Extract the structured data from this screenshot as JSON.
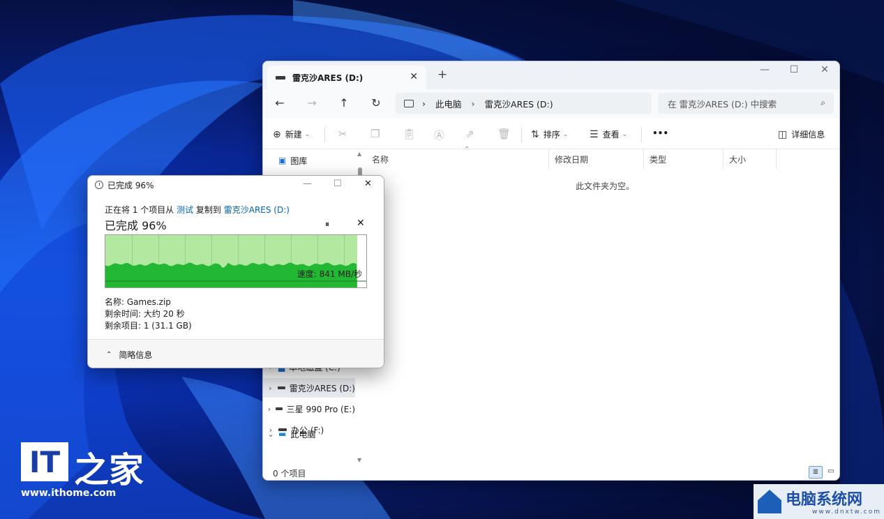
{
  "explorer": {
    "tab_title": "雷克沙ARES (D:)",
    "tab_close": "✕",
    "new_tab": "+",
    "controls": {
      "minimize": "—",
      "maximize": "☐",
      "close": "✕"
    },
    "nav": {
      "back": "←",
      "forward": "→",
      "up": "↑",
      "refresh": "↻"
    },
    "breadcrumb": [
      "此电脑",
      "雷克沙ARES (D:)"
    ],
    "breadcrumb_sep": "›",
    "search_placeholder": "在 雷克沙ARES (D:) 中搜索",
    "toolbar": {
      "new_label": "新建",
      "sort_label": "排序",
      "view_label": "查看",
      "more_label": "•••",
      "details_label": "详细信息"
    },
    "sidebar": {
      "items": [
        {
          "label": "图库",
          "icon": "gallery-icon",
          "chev": ""
        },
        {
          "label": "此电脑",
          "icon": "pc-icon",
          "chev": "⌄"
        },
        {
          "label": "本地磁盘 (C:)",
          "icon": "disk-icon",
          "chev": "›"
        },
        {
          "label": "雷克沙ARES (D:)",
          "icon": "drive-icon",
          "chev": "›",
          "selected": true
        },
        {
          "label": "三星 990 Pro (E:)",
          "icon": "drive-icon",
          "chev": "›"
        },
        {
          "label": "办公 (F:)",
          "icon": "drive-icon",
          "chev": "›"
        }
      ]
    },
    "columns": [
      "名称",
      "修改日期",
      "类型",
      "大小"
    ],
    "empty_message": "此文件夹为空。",
    "status": "0 个项目"
  },
  "copy_dialog": {
    "title": "已完成 96%",
    "controls": {
      "minimize": "—",
      "maximize": "☐",
      "close": "✕"
    },
    "copy_prefix": "正在将 1 个项目从 ",
    "source": "测试",
    "copy_middle": " 复制到 ",
    "destination": "雷克沙ARES (D:)",
    "progress_text": "已完成 96%",
    "progress_percent": 96,
    "pause_label": "⏸",
    "cancel_label": "✕",
    "speed_text": "速度: 841 MB/秒",
    "name_line": "名称: Games.zip",
    "time_line": "剩余时间: 大约 20 秒",
    "items_line": "剩余项目: 1 (31.1 GB)",
    "footer_label": "简略信息",
    "footer_chev": "⌃"
  },
  "watermarks": {
    "ithome_logo": "IT",
    "ithome_char": "之家",
    "ithome_url": "www.ithome.com",
    "dnxt_name": "电脑系统网",
    "dnxt_url": "www.dnxtw.com"
  },
  "colors": {
    "accent": "#0063b1",
    "progress_done": "#b3e8a0",
    "speed_fill": "#22b833"
  }
}
